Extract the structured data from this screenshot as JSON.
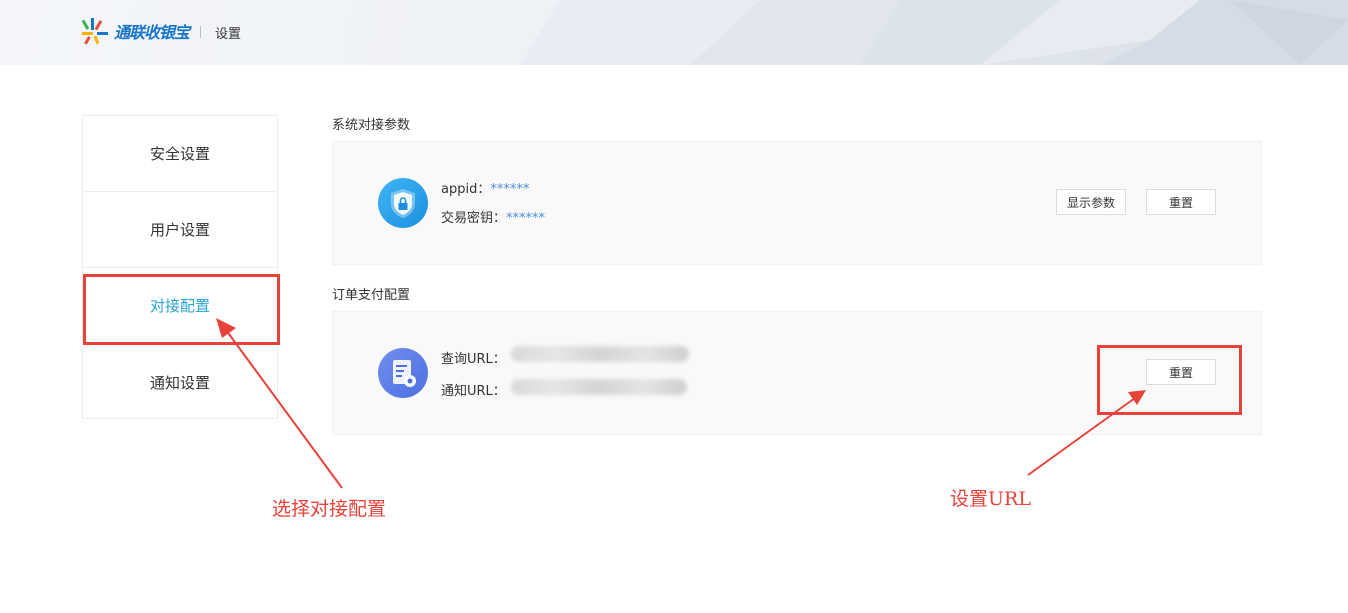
{
  "header": {
    "logo_text": "通联收银宝",
    "title": "设置"
  },
  "sidebar": {
    "items": [
      {
        "label": "安全设置",
        "active": false
      },
      {
        "label": "用户设置",
        "active": false
      },
      {
        "label": "对接配置",
        "active": true
      },
      {
        "label": "通知设置",
        "active": false
      }
    ]
  },
  "system_params": {
    "title": "系统对接参数",
    "icon": "shield-lock-icon",
    "appid_label": "appid：",
    "appid_value": "******",
    "key_label": "交易密钥：",
    "key_value": "******",
    "show_button": "显示参数",
    "reset_button": "重置"
  },
  "order_pay": {
    "title": "订单支付配置",
    "icon": "document-gear-icon",
    "query_label": "查询URL：",
    "notify_label": "通知URL：",
    "reset_button": "重置"
  },
  "annotations": {
    "left_note": "选择对接配置",
    "right_note": "设置URL",
    "color": "#e8423b"
  },
  "colors": {
    "accent": "#29a3d3",
    "value_blue": "#4a8fd8"
  }
}
